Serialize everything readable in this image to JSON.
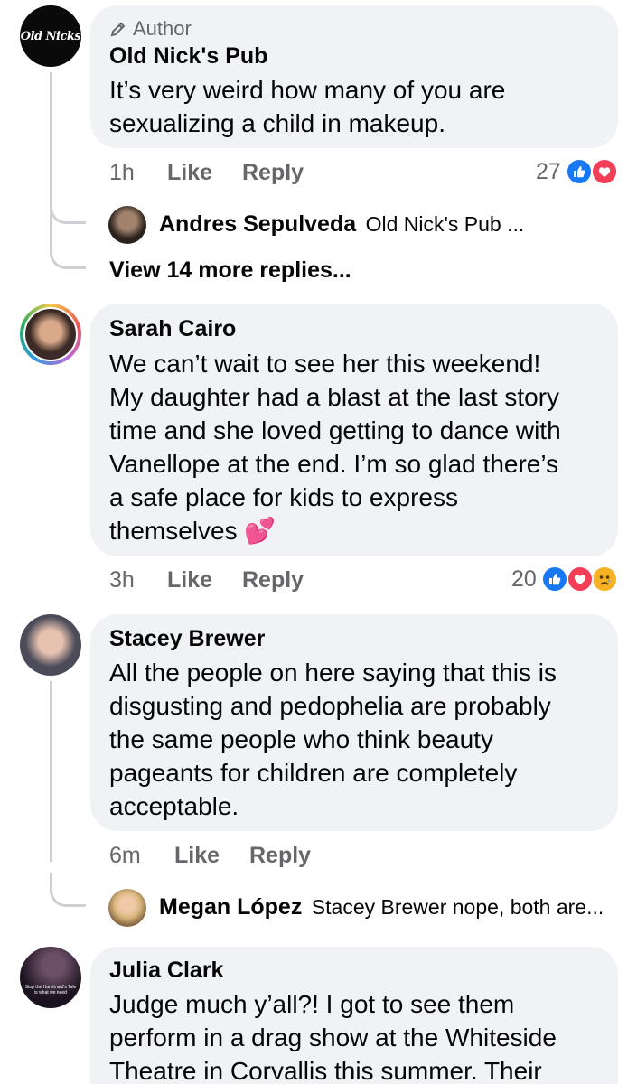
{
  "comments": [
    {
      "author_badge": "Author",
      "name": "Old Nick's Pub",
      "avatar_text": "Old Nicks",
      "text_lines": [
        "It’s very weird how many of you are",
        "sexualizing a child in makeup."
      ],
      "time": "1h",
      "like": "Like",
      "reply": "Reply",
      "reaction_count": "27",
      "reactions": [
        "like",
        "love"
      ],
      "replies": [
        {
          "name": "Andres Sepulveda",
          "preview": "Old Nick's Pub ..."
        }
      ],
      "view_more": "View 14 more replies..."
    },
    {
      "name": "Sarah Cairo",
      "text_lines": [
        "We can’t wait to see her this weekend!",
        "My daughter had a blast at the last story",
        "time and she loved getting to dance with",
        "Vanellope at the end. I’m so glad there’s",
        "a safe place for kids to express",
        "themselves"
      ],
      "emoji": "💕",
      "time": "3h",
      "like": "Like",
      "reply": "Reply",
      "reaction_count": "20",
      "reactions": [
        "like",
        "love",
        "sad"
      ]
    },
    {
      "name": "Stacey Brewer",
      "text_lines": [
        "All the people on here saying that this is",
        "disgusting and pedophelia are probably",
        "the same people who think beauty",
        "pageants for children are completely",
        "acceptable."
      ],
      "time": "6m",
      "like": "Like",
      "reply": "Reply",
      "replies": [
        {
          "name": "Megan López",
          "preview": "Stacey Brewer nope, both are..."
        }
      ]
    },
    {
      "name": "Julia Clark",
      "avatar_text": "Stop the Handmaid's Tale is what we need",
      "text_lines": [
        "Judge much y’all?!  I got to see them",
        "perform in a drag show at the Whiteside",
        "Theatre in Corvallis this summer. Their"
      ]
    }
  ],
  "colors": {
    "bubble": "#f0f2f5",
    "meta": "#65676b",
    "like_blue": "#1877f2",
    "love_red": "#f33e58",
    "sad_yellow": "#f7b125",
    "thread_line": "#ced0d4"
  },
  "icons": {
    "author_badge": "pencil-icon",
    "like_reaction": "thumbs-up-icon",
    "love_reaction": "heart-icon",
    "sad_reaction": "sad-face-icon"
  }
}
